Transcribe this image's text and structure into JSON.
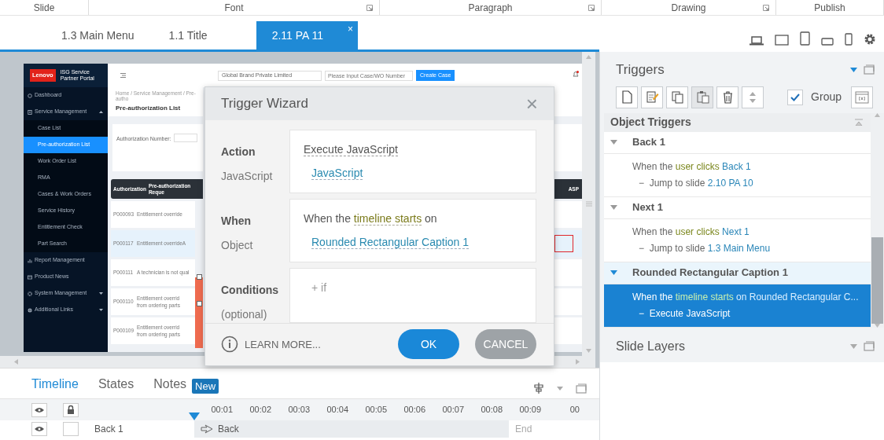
{
  "ribbon_groups": [
    {
      "label": "Slide",
      "launcher": false
    },
    {
      "label": "Font",
      "launcher": true
    },
    {
      "label": "Paragraph",
      "launcher": true
    },
    {
      "label": "Drawing",
      "launcher": true
    },
    {
      "label": "Publish",
      "launcher": false
    }
  ],
  "slide_tabs": [
    {
      "label": "1.3 Main Menu",
      "selected": false
    },
    {
      "label": "1.1 Title",
      "selected": false
    },
    {
      "label": "2.11 PA 11",
      "selected": true,
      "close": "×"
    }
  ],
  "slide": {
    "logo": "Lenovo",
    "portal_title": "ISG Service Partner Portal",
    "company_select": "Global Brand Private Limited",
    "search_placeholder": "Please Input Case/WO Number",
    "create_button": "Create Case",
    "breadcrumb": "Home / Service Management / Pre-autho",
    "page_title": "Pre-authorization List",
    "filter_label": "Authorization Number:",
    "sidebar": [
      {
        "label": "Dashboard",
        "selected": false
      },
      {
        "label": "Service Management",
        "selected": false,
        "expanded": true,
        "children": [
          {
            "label": "Case List",
            "selected": false
          },
          {
            "label": "Pre-authorization List",
            "selected": true
          },
          {
            "label": "Work Order List",
            "selected": false
          },
          {
            "label": "RMA",
            "selected": false
          },
          {
            "label": "Cases & Work Orders",
            "selected": false
          },
          {
            "label": "Service History",
            "selected": false
          },
          {
            "label": "Entitlement Check",
            "selected": false
          },
          {
            "label": "Part Search",
            "selected": false
          }
        ]
      },
      {
        "label": "Report Management",
        "selected": false
      },
      {
        "label": "Product News",
        "selected": false
      },
      {
        "label": "System Management",
        "selected": false,
        "expanded": false
      },
      {
        "label": "Additional Links",
        "selected": false,
        "expanded": false
      }
    ],
    "table": {
      "columns": [
        "Authorization",
        "Pre-authorization Reque"
      ],
      "right_column": "ASP",
      "rows": [
        {
          "id": "P000093",
          "description": [
            "Entitlement override"
          ],
          "selected": false,
          "flagged": false
        },
        {
          "id": "P000117",
          "description": [
            "Entitlement overrideA"
          ],
          "selected": true,
          "flagged": true
        },
        {
          "id": "P000111",
          "description": [
            "A technician is not qual"
          ],
          "selected": false,
          "flagged": false
        },
        {
          "id": "P000110",
          "description": [
            "Entitlement overrid",
            "from ordering parts"
          ],
          "selected": false,
          "flagged": false
        },
        {
          "id": "P000109",
          "description": [
            "Entitlement overrid",
            "from ordering parts"
          ],
          "selected": false,
          "flagged": false
        }
      ]
    }
  },
  "trigger_wizard": {
    "title": "Trigger Wizard",
    "close": "×",
    "sections": [
      {
        "labels": [
          {
            "text": "Action",
            "kind": "heading"
          },
          {
            "text": "JavaScript",
            "kind": "sub"
          }
        ],
        "lines": [
          [
            {
              "text": "Execute JavaScript",
              "kind": "choice"
            }
          ],
          [
            {
              "text": "JavaScript",
              "kind": "link"
            }
          ]
        ]
      },
      {
        "labels": [
          {
            "text": "When",
            "kind": "heading"
          },
          {
            "text": "Object",
            "kind": "sub"
          }
        ],
        "lines": [
          [
            {
              "text": "When the",
              "kind": "plain"
            },
            {
              "text": "timeline starts",
              "kind": "event"
            },
            {
              "text": "on",
              "kind": "plain"
            }
          ],
          [
            {
              "text": "Rounded Rectangular Caption 1",
              "kind": "link"
            }
          ]
        ]
      },
      {
        "labels": [
          {
            "text": "Conditions",
            "kind": "heading"
          },
          {
            "text": "(optional)",
            "kind": "sub"
          }
        ],
        "lines": [
          [
            {
              "text": "+ if",
              "kind": "add"
            }
          ]
        ]
      }
    ],
    "learn_more": "LEARN MORE...",
    "buttons": [
      {
        "label": "OK",
        "kind": "primary"
      },
      {
        "label": "CANCEL",
        "kind": "secondary"
      }
    ]
  },
  "triggers_panel": {
    "title": "Triggers",
    "group_checkbox": {
      "label": "Group",
      "checked": true
    },
    "section_title": "Object Triggers",
    "groups": [
      {
        "name": "Back 1",
        "expanded": true,
        "selected": false,
        "triggers": [
          {
            "selected": false,
            "condition": [
              {
                "text": "When the",
                "kind": "plain"
              },
              {
                "text": "user clicks",
                "kind": "event"
              },
              {
                "text": "Back 1",
                "kind": "object"
              }
            ],
            "action": [
              {
                "text": "−",
                "kind": "plain"
              },
              {
                "text": "Jump to slide",
                "kind": "plain"
              },
              {
                "text": "2.10 PA 10",
                "kind": "object"
              }
            ]
          }
        ]
      },
      {
        "name": "Next 1",
        "expanded": true,
        "selected": false,
        "triggers": [
          {
            "selected": false,
            "condition": [
              {
                "text": "When the",
                "kind": "plain"
              },
              {
                "text": "user clicks",
                "kind": "event"
              },
              {
                "text": "Next 1",
                "kind": "object"
              }
            ],
            "action": [
              {
                "text": "−",
                "kind": "plain"
              },
              {
                "text": "Jump to slide",
                "kind": "plain"
              },
              {
                "text": "1.3 Main Menu",
                "kind": "object"
              }
            ]
          }
        ]
      },
      {
        "name": "Rounded Rectangular Caption 1",
        "expanded": true,
        "selected": true,
        "triggers": [
          {
            "selected": true,
            "condition": [
              {
                "text": "When the",
                "kind": "plain"
              },
              {
                "text": "timeline starts",
                "kind": "event"
              },
              {
                "text": "on Rounded Rectangular C...",
                "kind": "object"
              }
            ],
            "action": [
              {
                "text": "−",
                "kind": "plain"
              },
              {
                "text": "Execute JavaScript",
                "kind": "plain"
              }
            ]
          }
        ]
      }
    ],
    "slide_layers_title": "Slide Layers"
  },
  "timeline": {
    "tabs": [
      {
        "label": "Timeline",
        "selected": true
      },
      {
        "label": "States",
        "selected": false
      },
      {
        "label": "Notes",
        "selected": false
      }
    ],
    "badge": "New",
    "ticks": [
      "00:01",
      "00:02",
      "00:03",
      "00:04",
      "00:05",
      "00:06",
      "00:07",
      "00:08",
      "00:09",
      "00"
    ],
    "rows": [
      {
        "name": "Back 1",
        "visible": true,
        "locked": false,
        "track_label": "Back",
        "end_label": "End"
      }
    ]
  }
}
